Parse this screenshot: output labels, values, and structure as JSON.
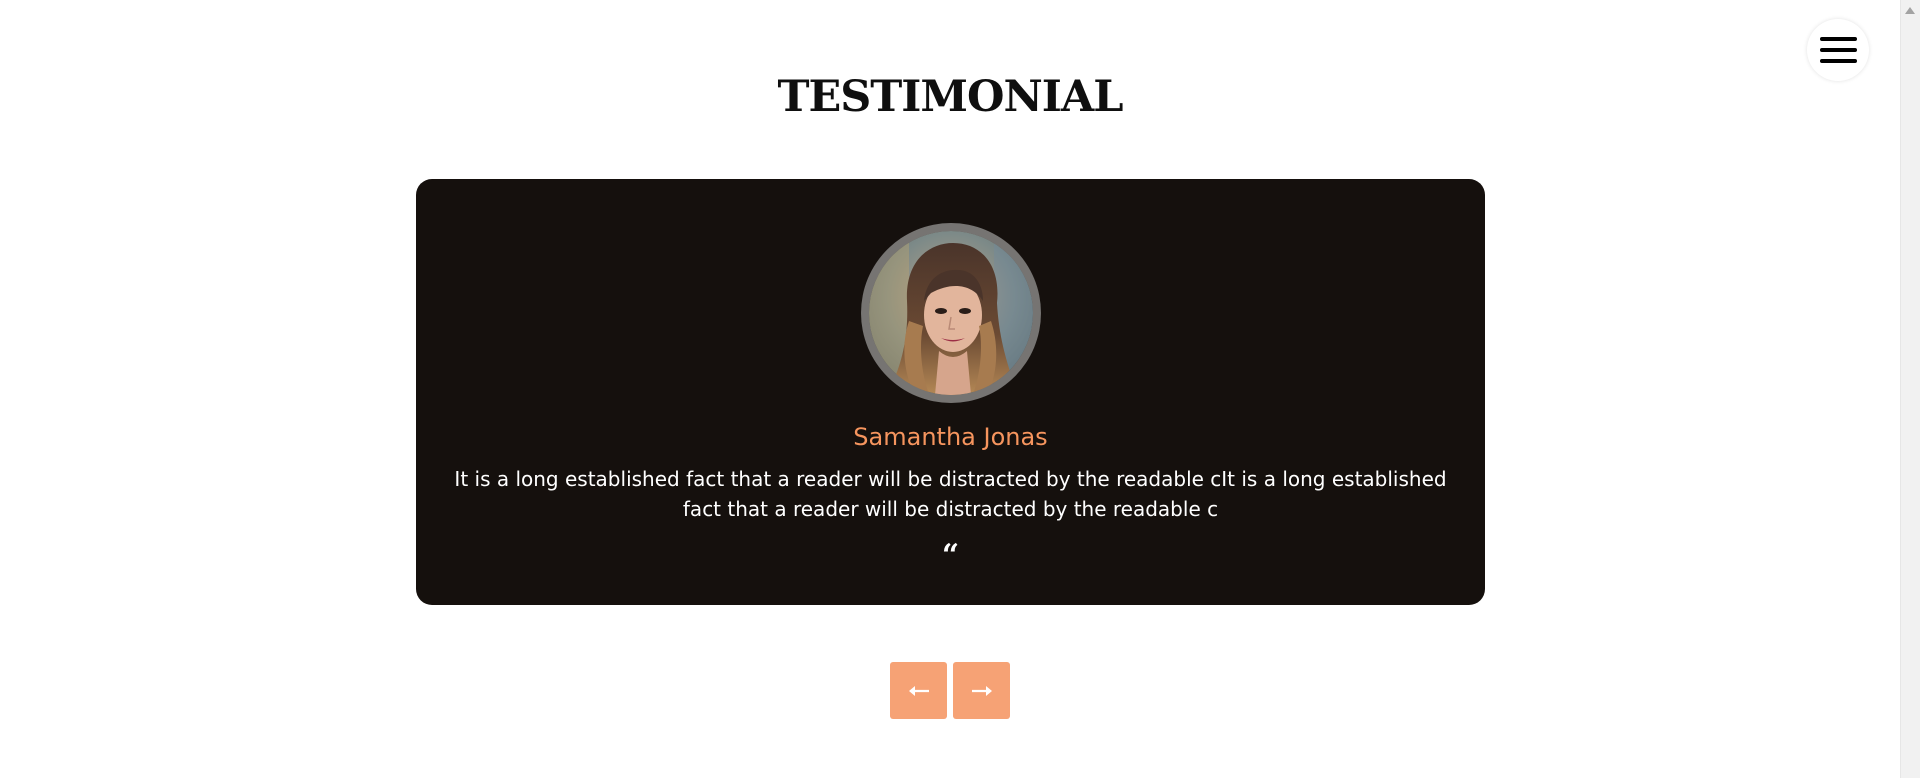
{
  "section": {
    "title": "TESTIMONIAL"
  },
  "testimonial": {
    "name": "Samantha Jonas",
    "text": "It is a long established fact that a reader will be distracted by the readable cIt is a long established fact that a reader will be distracted by the readable c",
    "quote_glyph": "“"
  },
  "menu": {
    "icon": "hamburger-icon"
  },
  "navigation": {
    "prev_icon": "arrow-left-icon",
    "next_icon": "arrow-right-icon"
  },
  "colors": {
    "card_background": "#15100d",
    "accent": "#f6955e",
    "button_background": "#f6a275",
    "avatar_ring": "#767472"
  }
}
